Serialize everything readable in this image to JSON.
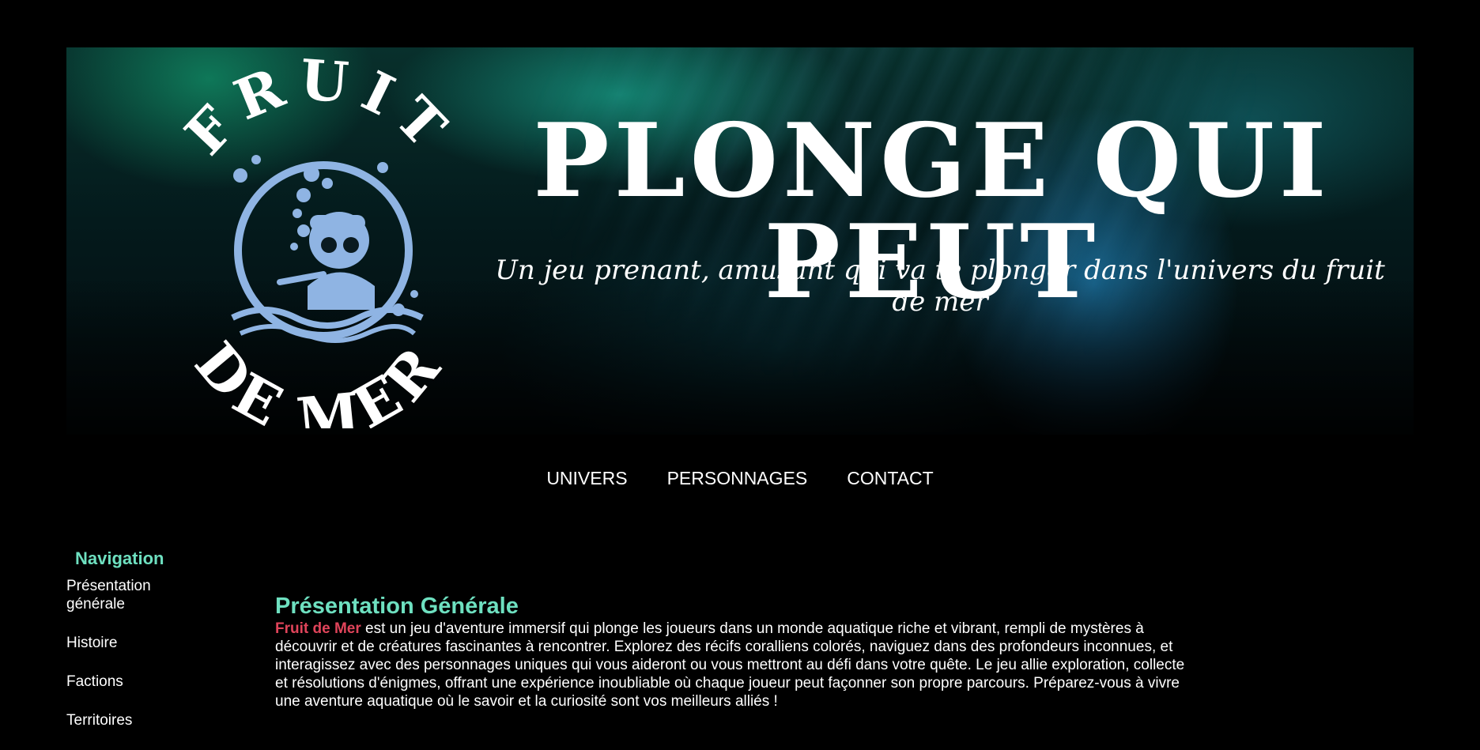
{
  "banner": {
    "logo_top": "FRUIT",
    "logo_bottom": "DE MER",
    "headline": "PLONGE QUI PEUT",
    "tagline": "Un jeu prenant, amusant qui va te plonger dans l'univers du fruit de mer"
  },
  "topnav": {
    "items": [
      {
        "label": "UNIVERS"
      },
      {
        "label": "PERSONNAGES"
      },
      {
        "label": "CONTACT"
      }
    ]
  },
  "sidebar": {
    "title": "Navigation",
    "items": [
      {
        "label": "Présentation générale"
      },
      {
        "label": "Histoire"
      },
      {
        "label": "Factions"
      },
      {
        "label": "Territoires"
      }
    ]
  },
  "main": {
    "title": "Présentation Générale",
    "brand": "Fruit de Mer",
    "text": " est un jeu d'aventure immersif qui plonge les joueurs dans un monde aquatique riche et vibrant, rempli de mystères à découvrir et de créatures fascinantes à rencontrer. Explorez des récifs coralliens colorés, naviguez dans des profondeurs inconnues, et interagissez avec des personnages uniques qui vous aideront ou vous mettront au défi dans votre quête. Le jeu allie exploration, collecte et résolutions d'énigmes, offrant une expérience inoubliable où chaque joueur peut façonner son propre parcours. Préparez-vous à vivre une aventure aquatique où le savoir et la curiosité sont vos meilleurs alliés !"
  },
  "colors": {
    "accent": "#6ee0c0",
    "brand": "#e0445a",
    "logo_blue": "#8fb4e3"
  }
}
